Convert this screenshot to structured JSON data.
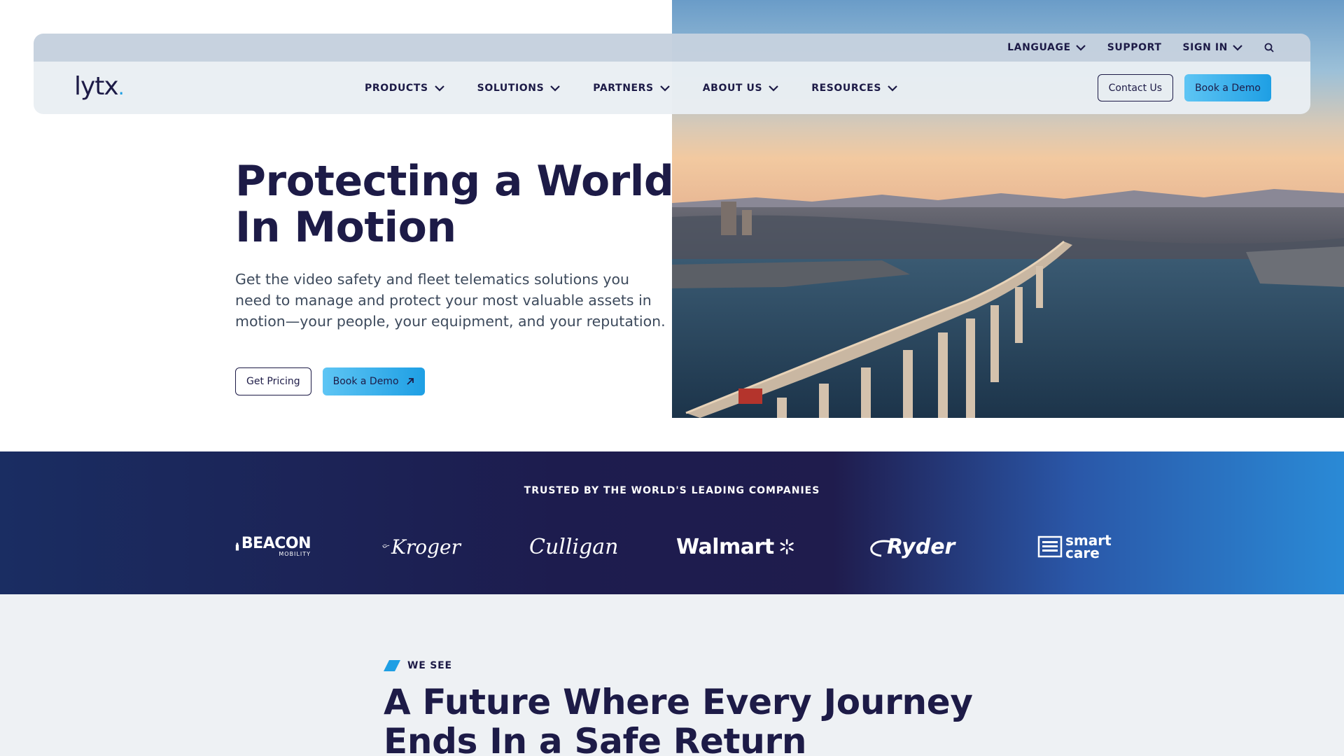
{
  "utility_nav": {
    "language": "LANGUAGE",
    "support": "SUPPORT",
    "sign_in": "SIGN IN"
  },
  "logo": {
    "text": "lytx",
    "dot": "."
  },
  "main_nav": {
    "items": [
      {
        "label": "PRODUCTS"
      },
      {
        "label": "SOLUTIONS"
      },
      {
        "label": "PARTNERS"
      },
      {
        "label": "ABOUT US"
      },
      {
        "label": "RESOURCES"
      }
    ],
    "contact_label": "Contact Us",
    "demo_label": "Book a Demo"
  },
  "hero": {
    "title": "Protecting a World In Motion",
    "subtitle": "Get the video safety and fleet telematics solutions you need to manage and protect your most valuable assets in motion—your people, your equipment, and your reputation.",
    "pricing_label": "Get Pricing",
    "demo_label": "Book a Demo"
  },
  "trusted": {
    "heading": "TRUSTED BY THE WORLD'S LEADING COMPANIES",
    "logos": [
      {
        "name": "beacon-logo",
        "text": "BEACON",
        "subtext": "MOBILITY"
      },
      {
        "name": "kroger-logo",
        "text": "Kroger"
      },
      {
        "name": "culligan-logo",
        "text": "Culligan"
      },
      {
        "name": "walmart-logo",
        "text": "Walmart"
      },
      {
        "name": "ryder-logo",
        "text": "Ryder"
      },
      {
        "name": "smartcare-logo",
        "text": "smart",
        "subtext": "care"
      }
    ]
  },
  "mission": {
    "eyebrow": "WE SEE",
    "title": "A Future Where Every Journey Ends In a Safe Return"
  },
  "colors": {
    "navy": "#1d1b47",
    "accent_blue": "#1e9fe4",
    "header_bg": "#e9eef3",
    "utility_bg": "#c5d1de",
    "band_dark": "#1d1c4e",
    "band_light": "#2a8ad6",
    "section_bg": "#eef1f4"
  },
  "icons": {
    "dropdown": "chevron-down-icon",
    "search": "search-icon",
    "external": "arrow-up-right-icon",
    "eyebrow": "slash-accent-icon"
  }
}
